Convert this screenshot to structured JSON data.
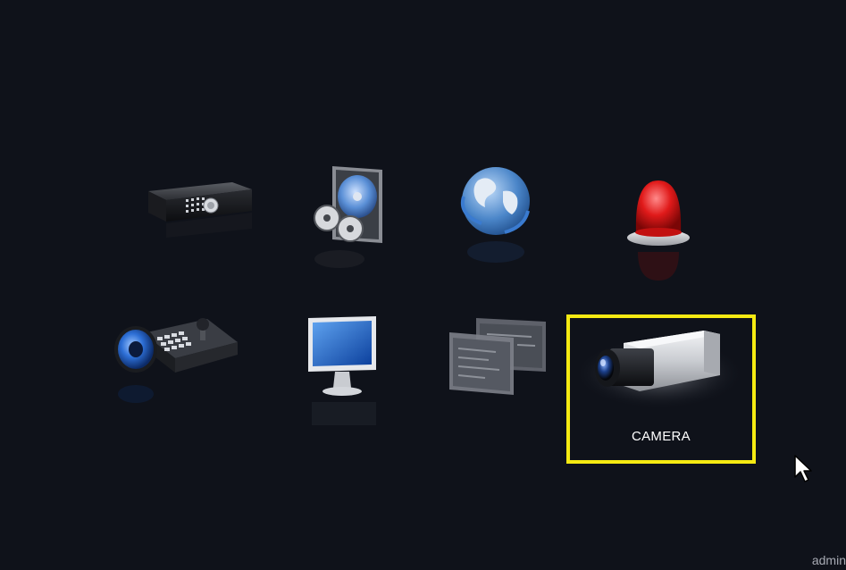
{
  "menu": {
    "items": [
      {
        "id": "record",
        "icon": "dvr-recorder-icon",
        "label": ""
      },
      {
        "id": "hdd",
        "icon": "hard-disk-icon",
        "label": ""
      },
      {
        "id": "network",
        "icon": "globe-network-icon",
        "label": ""
      },
      {
        "id": "alarm",
        "icon": "alarm-siren-icon",
        "label": ""
      },
      {
        "id": "ptz",
        "icon": "ptz-keyboard-icon",
        "label": ""
      },
      {
        "id": "display",
        "icon": "monitor-icon",
        "label": ""
      },
      {
        "id": "system",
        "icon": "panels-icon",
        "label": ""
      },
      {
        "id": "camera",
        "icon": "camera-icon",
        "label": "CAMERA",
        "selected": true
      }
    ],
    "selection_color": "#f5ea12"
  },
  "status": {
    "user": "admin"
  },
  "colors": {
    "background": "#0f121a",
    "text": "#ffffff"
  }
}
